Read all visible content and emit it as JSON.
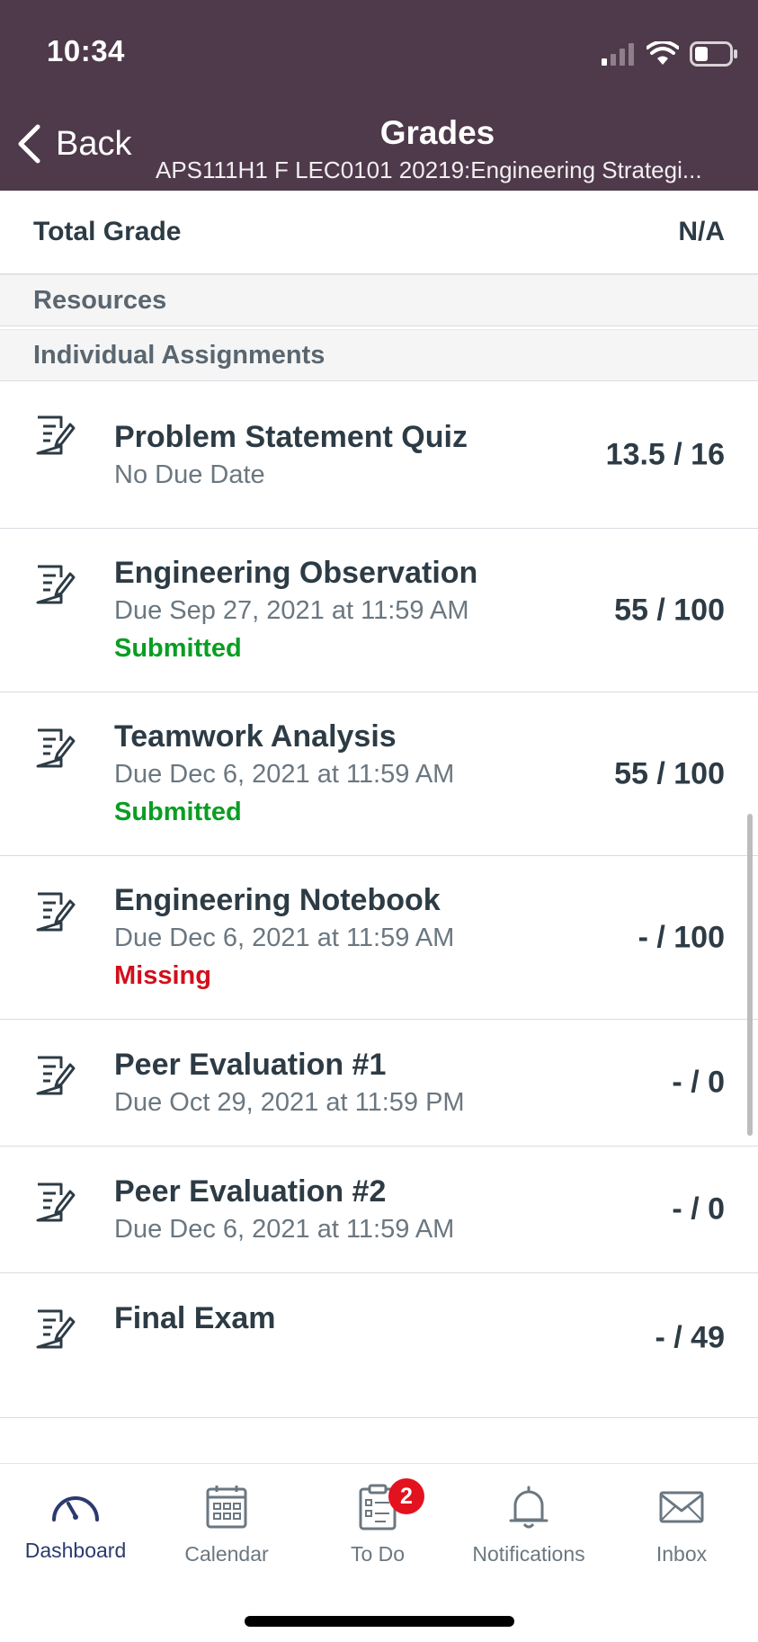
{
  "status_bar": {
    "time": "10:34"
  },
  "header": {
    "back_label": "Back",
    "title": "Grades",
    "subtitle": "APS111H1 F LEC0101 20219:Engineering Strategi..."
  },
  "total": {
    "label": "Total Grade",
    "value": "N/A"
  },
  "sections": [
    {
      "title": "Resources"
    },
    {
      "title": "Individual Assignments"
    }
  ],
  "assignments": [
    {
      "title": "Problem Statement Quiz",
      "due": "No Due Date",
      "status": "",
      "score": "13.5 / 16"
    },
    {
      "title": "Engineering Observation",
      "due": "Due Sep 27, 2021 at 11:59 AM",
      "status": "Submitted",
      "score": "55 / 100"
    },
    {
      "title": "Teamwork Analysis",
      "due": "Due Dec 6, 2021 at 11:59 AM",
      "status": "Submitted",
      "score": "55 / 100"
    },
    {
      "title": "Engineering Notebook",
      "due": "Due Dec 6, 2021 at 11:59 AM",
      "status": "Missing",
      "score": "- / 100"
    },
    {
      "title": "Peer Evaluation #1",
      "due": "Due Oct 29, 2021 at 11:59 PM",
      "status": "",
      "score": "- / 0"
    },
    {
      "title": "Peer Evaluation #2",
      "due": "Due Dec 6, 2021 at 11:59 AM",
      "status": "",
      "score": "- / 0"
    },
    {
      "title": "Final Exam",
      "due": "",
      "status": "",
      "score": "- / 49"
    }
  ],
  "tabbar": {
    "tabs": [
      {
        "label": "Dashboard",
        "icon": "dashboard-gauge-icon",
        "active": true
      },
      {
        "label": "Calendar",
        "icon": "calendar-icon"
      },
      {
        "label": "To Do",
        "icon": "todo-clipboard-icon",
        "badge": "2"
      },
      {
        "label": "Notifications",
        "icon": "bell-icon"
      },
      {
        "label": "Inbox",
        "icon": "envelope-icon"
      }
    ]
  },
  "colors": {
    "header_bg": "#4e3a4a",
    "submitted": "#0b9d22",
    "missing": "#d0101c",
    "active_tab": "#2c3a6e",
    "badge": "#e3121f"
  }
}
